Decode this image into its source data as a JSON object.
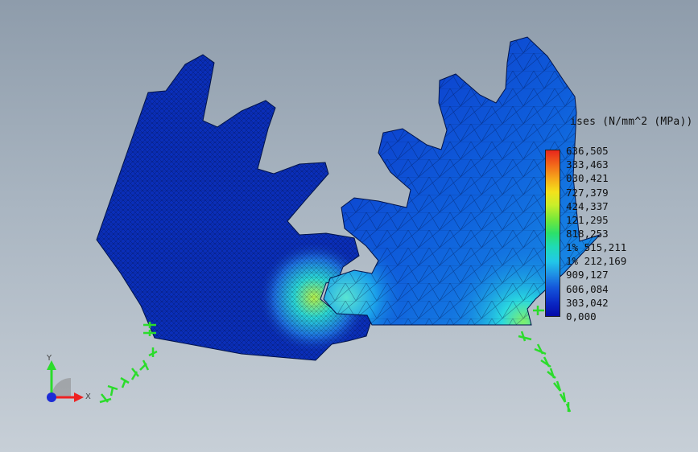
{
  "legend": {
    "title": "ises (N/mm^2 (MPa))",
    "labels": [
      "636,505",
      "333,463",
      "030,421",
      "727,379",
      "424,337",
      "121,295",
      "818,253",
      "1% 515,211",
      "1% 212,169",
      "909,127",
      "606,084",
      "303,042",
      "0,000"
    ],
    "colors": [
      "#e8271c",
      "#f6a81a",
      "#f4e11b",
      "#73e83b",
      "#22c8e8",
      "#1f8fe5",
      "#050aa8"
    ]
  },
  "triad": {
    "x_label": "X",
    "y_label": "Y"
  },
  "icons": [
    "gear-left-mesh",
    "gear-right-mesh",
    "fixture-arrow-icon",
    "axis-triad-icon"
  ]
}
